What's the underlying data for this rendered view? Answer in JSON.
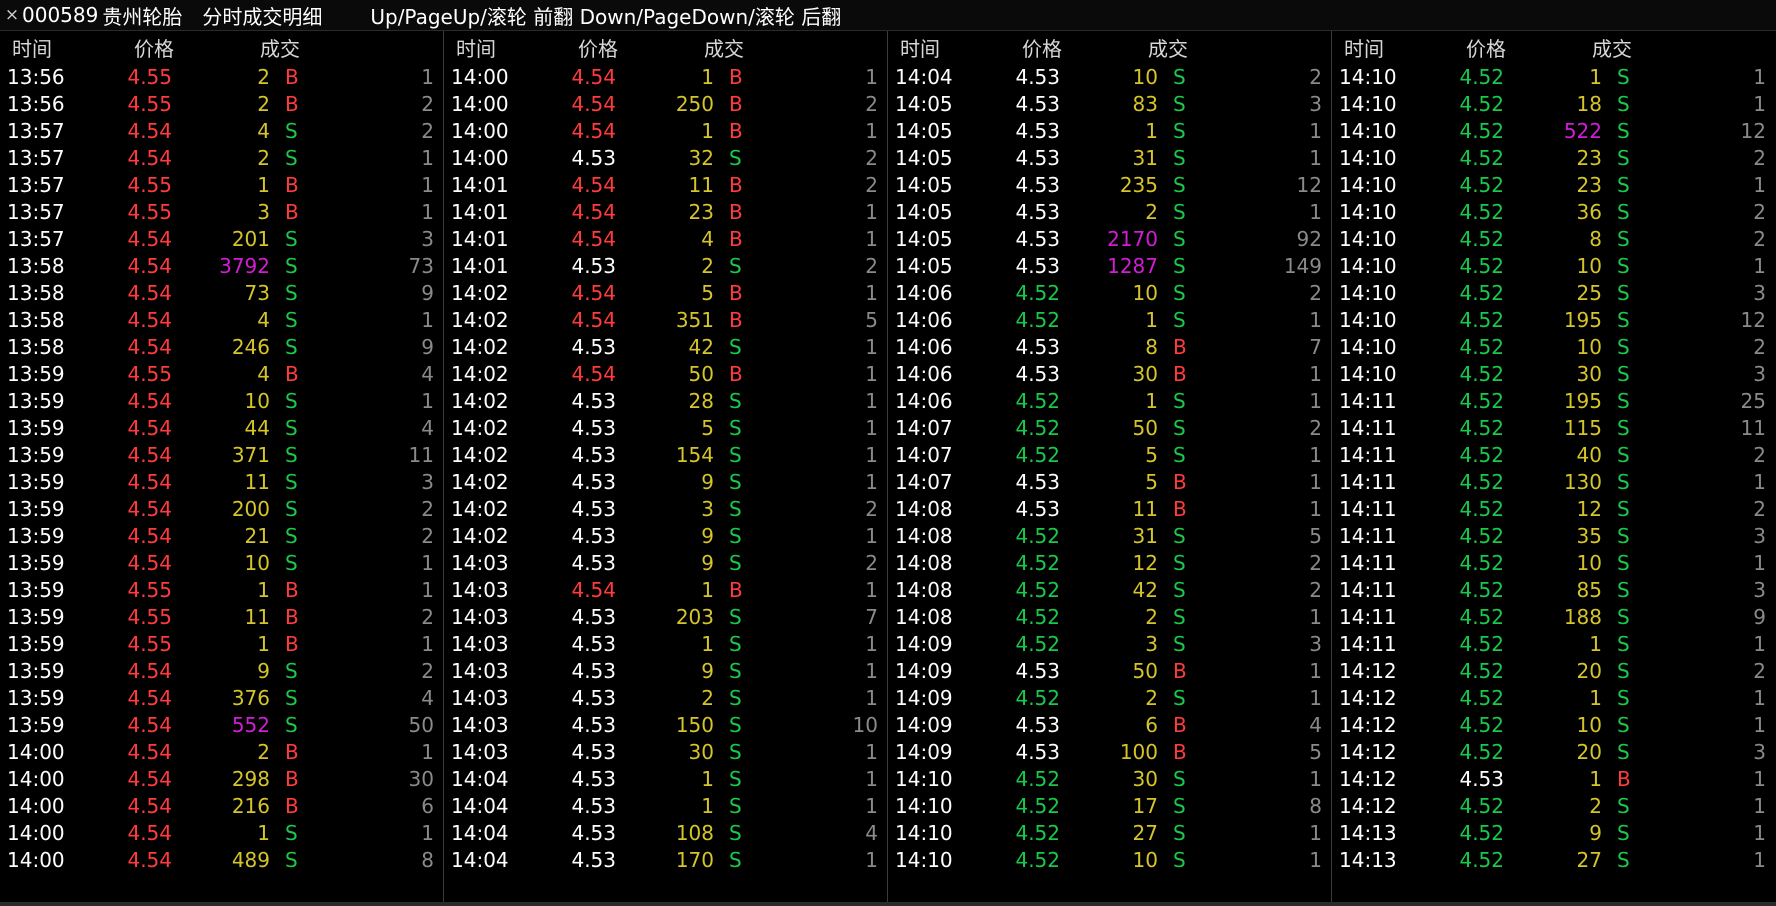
{
  "header": {
    "close_glyph": "×",
    "code": "000589",
    "name": "贵州轮胎",
    "title": "分时成交明细",
    "hint": "Up/PageUp/滚轮 前翻 Down/PageDown/滚轮 后翻"
  },
  "columns": {
    "time": "时间",
    "price": "价格",
    "volume": "成交"
  },
  "colors": {
    "up": "#ff3b3b",
    "down": "#19c94a",
    "flat": "#ffffff",
    "volume": "#d6c52a",
    "big_volume": "#d21cd6",
    "count": "#8a8a8a"
  },
  "panels": [
    {
      "rows": [
        [
          "13:56",
          "4.55",
          "2",
          "B",
          "1"
        ],
        [
          "13:56",
          "4.55",
          "2",
          "B",
          "2"
        ],
        [
          "13:57",
          "4.54",
          "4",
          "S",
          "2"
        ],
        [
          "13:57",
          "4.54",
          "2",
          "S",
          "1"
        ],
        [
          "13:57",
          "4.55",
          "1",
          "B",
          "1"
        ],
        [
          "13:57",
          "4.55",
          "3",
          "B",
          "1"
        ],
        [
          "13:57",
          "4.54",
          "201",
          "S",
          "3"
        ],
        [
          "13:58",
          "4.54",
          "3792",
          "S",
          "73"
        ],
        [
          "13:58",
          "4.54",
          "73",
          "S",
          "9"
        ],
        [
          "13:58",
          "4.54",
          "4",
          "S",
          "1"
        ],
        [
          "13:58",
          "4.54",
          "246",
          "S",
          "9"
        ],
        [
          "13:59",
          "4.55",
          "4",
          "B",
          "4"
        ],
        [
          "13:59",
          "4.54",
          "10",
          "S",
          "1"
        ],
        [
          "13:59",
          "4.54",
          "44",
          "S",
          "4"
        ],
        [
          "13:59",
          "4.54",
          "371",
          "S",
          "11"
        ],
        [
          "13:59",
          "4.54",
          "11",
          "S",
          "3"
        ],
        [
          "13:59",
          "4.54",
          "200",
          "S",
          "2"
        ],
        [
          "13:59",
          "4.54",
          "21",
          "S",
          "2"
        ],
        [
          "13:59",
          "4.54",
          "10",
          "S",
          "1"
        ],
        [
          "13:59",
          "4.55",
          "1",
          "B",
          "1"
        ],
        [
          "13:59",
          "4.55",
          "11",
          "B",
          "2"
        ],
        [
          "13:59",
          "4.55",
          "1",
          "B",
          "1"
        ],
        [
          "13:59",
          "4.54",
          "9",
          "S",
          "2"
        ],
        [
          "13:59",
          "4.54",
          "376",
          "S",
          "4"
        ],
        [
          "13:59",
          "4.54",
          "552",
          "S",
          "50"
        ],
        [
          "14:00",
          "4.54",
          "2",
          "B",
          "1"
        ],
        [
          "14:00",
          "4.54",
          "298",
          "B",
          "30"
        ],
        [
          "14:00",
          "4.54",
          "216",
          "B",
          "6"
        ],
        [
          "14:00",
          "4.54",
          "1",
          "S",
          "1"
        ],
        [
          "14:00",
          "4.54",
          "489",
          "S",
          "8"
        ]
      ]
    },
    {
      "rows": [
        [
          "14:00",
          "4.54",
          "1",
          "B",
          "1"
        ],
        [
          "14:00",
          "4.54",
          "250",
          "B",
          "2"
        ],
        [
          "14:00",
          "4.54",
          "1",
          "B",
          "1"
        ],
        [
          "14:00",
          "4.53",
          "32",
          "S",
          "2"
        ],
        [
          "14:01",
          "4.54",
          "11",
          "B",
          "2"
        ],
        [
          "14:01",
          "4.54",
          "23",
          "B",
          "1"
        ],
        [
          "14:01",
          "4.54",
          "4",
          "B",
          "1"
        ],
        [
          "14:01",
          "4.53",
          "2",
          "S",
          "2"
        ],
        [
          "14:02",
          "4.54",
          "5",
          "B",
          "1"
        ],
        [
          "14:02",
          "4.54",
          "351",
          "B",
          "5"
        ],
        [
          "14:02",
          "4.53",
          "42",
          "S",
          "1"
        ],
        [
          "14:02",
          "4.54",
          "50",
          "B",
          "1"
        ],
        [
          "14:02",
          "4.53",
          "28",
          "S",
          "1"
        ],
        [
          "14:02",
          "4.53",
          "5",
          "S",
          "1"
        ],
        [
          "14:02",
          "4.53",
          "154",
          "S",
          "1"
        ],
        [
          "14:02",
          "4.53",
          "9",
          "S",
          "1"
        ],
        [
          "14:02",
          "4.53",
          "3",
          "S",
          "2"
        ],
        [
          "14:02",
          "4.53",
          "9",
          "S",
          "1"
        ],
        [
          "14:03",
          "4.53",
          "9",
          "S",
          "2"
        ],
        [
          "14:03",
          "4.54",
          "1",
          "B",
          "1"
        ],
        [
          "14:03",
          "4.53",
          "203",
          "S",
          "7"
        ],
        [
          "14:03",
          "4.53",
          "1",
          "S",
          "1"
        ],
        [
          "14:03",
          "4.53",
          "9",
          "S",
          "1"
        ],
        [
          "14:03",
          "4.53",
          "2",
          "S",
          "1"
        ],
        [
          "14:03",
          "4.53",
          "150",
          "S",
          "10"
        ],
        [
          "14:03",
          "4.53",
          "30",
          "S",
          "1"
        ],
        [
          "14:04",
          "4.53",
          "1",
          "S",
          "1"
        ],
        [
          "14:04",
          "4.53",
          "1",
          "S",
          "1"
        ],
        [
          "14:04",
          "4.53",
          "108",
          "S",
          "4"
        ],
        [
          "14:04",
          "4.53",
          "170",
          "S",
          "1"
        ]
      ]
    },
    {
      "rows": [
        [
          "14:04",
          "4.53",
          "10",
          "S",
          "2"
        ],
        [
          "14:05",
          "4.53",
          "83",
          "S",
          "3"
        ],
        [
          "14:05",
          "4.53",
          "1",
          "S",
          "1"
        ],
        [
          "14:05",
          "4.53",
          "31",
          "S",
          "1"
        ],
        [
          "14:05",
          "4.53",
          "235",
          "S",
          "12"
        ],
        [
          "14:05",
          "4.53",
          "2",
          "S",
          "1"
        ],
        [
          "14:05",
          "4.53",
          "2170",
          "S",
          "92"
        ],
        [
          "14:05",
          "4.53",
          "1287",
          "S",
          "149"
        ],
        [
          "14:06",
          "4.52",
          "10",
          "S",
          "2"
        ],
        [
          "14:06",
          "4.52",
          "1",
          "S",
          "1"
        ],
        [
          "14:06",
          "4.53",
          "8",
          "B",
          "7"
        ],
        [
          "14:06",
          "4.53",
          "30",
          "B",
          "1"
        ],
        [
          "14:06",
          "4.52",
          "1",
          "S",
          "1"
        ],
        [
          "14:07",
          "4.52",
          "50",
          "S",
          "2"
        ],
        [
          "14:07",
          "4.52",
          "5",
          "S",
          "1"
        ],
        [
          "14:07",
          "4.53",
          "5",
          "B",
          "1"
        ],
        [
          "14:08",
          "4.53",
          "11",
          "B",
          "1"
        ],
        [
          "14:08",
          "4.52",
          "31",
          "S",
          "5"
        ],
        [
          "14:08",
          "4.52",
          "12",
          "S",
          "2"
        ],
        [
          "14:08",
          "4.52",
          "42",
          "S",
          "2"
        ],
        [
          "14:08",
          "4.52",
          "2",
          "S",
          "1"
        ],
        [
          "14:09",
          "4.52",
          "3",
          "S",
          "3"
        ],
        [
          "14:09",
          "4.53",
          "50",
          "B",
          "1"
        ],
        [
          "14:09",
          "4.52",
          "2",
          "S",
          "1"
        ],
        [
          "14:09",
          "4.53",
          "6",
          "B",
          "4"
        ],
        [
          "14:09",
          "4.53",
          "100",
          "B",
          "5"
        ],
        [
          "14:10",
          "4.52",
          "30",
          "S",
          "1"
        ],
        [
          "14:10",
          "4.52",
          "17",
          "S",
          "8"
        ],
        [
          "14:10",
          "4.52",
          "27",
          "S",
          "1"
        ],
        [
          "14:10",
          "4.52",
          "10",
          "S",
          "1"
        ]
      ]
    },
    {
      "rows": [
        [
          "14:10",
          "4.52",
          "1",
          "S",
          "1"
        ],
        [
          "14:10",
          "4.52",
          "18",
          "S",
          "1"
        ],
        [
          "14:10",
          "4.52",
          "522",
          "S",
          "12"
        ],
        [
          "14:10",
          "4.52",
          "23",
          "S",
          "2"
        ],
        [
          "14:10",
          "4.52",
          "23",
          "S",
          "1"
        ],
        [
          "14:10",
          "4.52",
          "36",
          "S",
          "2"
        ],
        [
          "14:10",
          "4.52",
          "8",
          "S",
          "2"
        ],
        [
          "14:10",
          "4.52",
          "10",
          "S",
          "1"
        ],
        [
          "14:10",
          "4.52",
          "25",
          "S",
          "3"
        ],
        [
          "14:10",
          "4.52",
          "195",
          "S",
          "12"
        ],
        [
          "14:10",
          "4.52",
          "10",
          "S",
          "2"
        ],
        [
          "14:10",
          "4.52",
          "30",
          "S",
          "3"
        ],
        [
          "14:11",
          "4.52",
          "195",
          "S",
          "25"
        ],
        [
          "14:11",
          "4.52",
          "115",
          "S",
          "11"
        ],
        [
          "14:11",
          "4.52",
          "40",
          "S",
          "2"
        ],
        [
          "14:11",
          "4.52",
          "130",
          "S",
          "1"
        ],
        [
          "14:11",
          "4.52",
          "12",
          "S",
          "2"
        ],
        [
          "14:11",
          "4.52",
          "35",
          "S",
          "3"
        ],
        [
          "14:11",
          "4.52",
          "10",
          "S",
          "1"
        ],
        [
          "14:11",
          "4.52",
          "85",
          "S",
          "3"
        ],
        [
          "14:11",
          "4.52",
          "188",
          "S",
          "9"
        ],
        [
          "14:11",
          "4.52",
          "1",
          "S",
          "1"
        ],
        [
          "14:12",
          "4.52",
          "20",
          "S",
          "2"
        ],
        [
          "14:12",
          "4.52",
          "1",
          "S",
          "1"
        ],
        [
          "14:12",
          "4.52",
          "10",
          "S",
          "1"
        ],
        [
          "14:12",
          "4.52",
          "20",
          "S",
          "3"
        ],
        [
          "14:12",
          "4.53",
          "1",
          "B",
          "1"
        ],
        [
          "14:12",
          "4.52",
          "2",
          "S",
          "1"
        ],
        [
          "14:13",
          "4.52",
          "9",
          "S",
          "1"
        ],
        [
          "14:13",
          "4.52",
          "27",
          "S",
          "1"
        ]
      ]
    }
  ]
}
